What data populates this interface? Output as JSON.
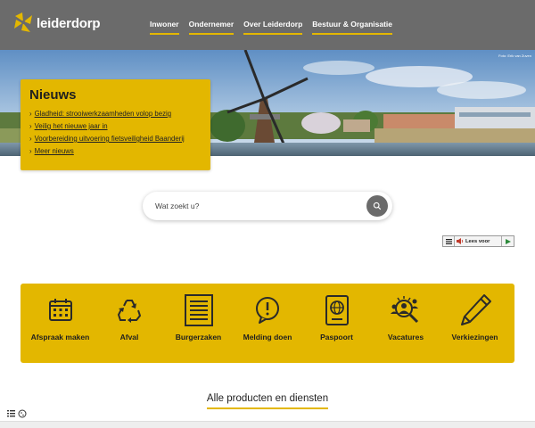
{
  "brand": {
    "name": "leiderdorp",
    "accent": "#e3b700",
    "header_bg": "#6b6b6b"
  },
  "nav": [
    {
      "label": "Inwoner"
    },
    {
      "label": "Ondernemer"
    },
    {
      "label": "Over Leiderdorp"
    },
    {
      "label": "Bestuur & Organisatie"
    }
  ],
  "hero": {
    "photo_credit": "Foto: Erik van Zuven"
  },
  "news": {
    "title": "Nieuws",
    "items": [
      {
        "label": "Gladheid: strooiwerkzaamheden volop bezig"
      },
      {
        "label": "Veilig het nieuwe jaar in"
      },
      {
        "label": "Voorbereiding uitvoering fietsveiligheid Baanderij"
      },
      {
        "label": "Meer nieuws"
      }
    ]
  },
  "search": {
    "placeholder": "Wat zoekt u?",
    "icon": "search-icon"
  },
  "readspeaker": {
    "label": "Lees voor"
  },
  "tiles": [
    {
      "label": "Afspraak maken",
      "icon": "calendar-icon"
    },
    {
      "label": "Afval",
      "icon": "recycle-icon"
    },
    {
      "label": "Burgerzaken",
      "icon": "document-icon"
    },
    {
      "label": "Melding doen",
      "icon": "alert-icon"
    },
    {
      "label": "Paspoort",
      "icon": "passport-icon"
    },
    {
      "label": "Vacatures",
      "icon": "vacancy-icon"
    },
    {
      "label": "Verkiezingen",
      "icon": "pencil-icon"
    }
  ],
  "all_products": {
    "label": "Alle producten en diensten"
  }
}
